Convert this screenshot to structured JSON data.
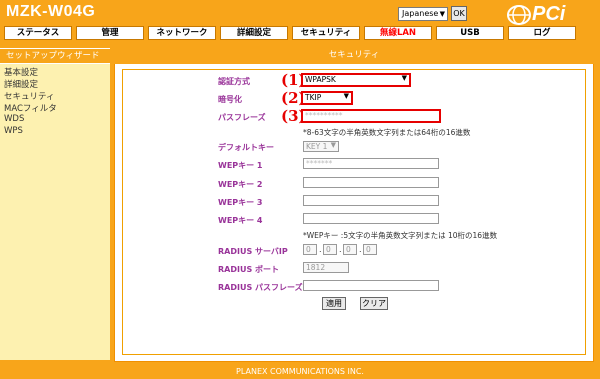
{
  "header": {
    "model": "MZK-W04G",
    "language_value": "Japanese",
    "ok_label": "OK",
    "brand_text": "PCi"
  },
  "nav": {
    "items": [
      "ステータス",
      "管理",
      "ネットワーク",
      "詳細設定",
      "セキュリティ",
      "無線LAN",
      "USB",
      "ログ"
    ],
    "active": "無線LAN"
  },
  "sidebar": {
    "header": "セットアップウィザード",
    "items": [
      "基本設定",
      "詳細設定",
      "セキュリティ",
      "MACフィルタ",
      "WDS",
      "WPS"
    ]
  },
  "main": {
    "title": "セキュリティ",
    "labels": {
      "auth": "認証方式",
      "enc": "暗号化",
      "passphrase": "パスフレーズ",
      "default_key": "デフォルトキー",
      "wep1": "WEPキー 1",
      "wep2": "WEPキー 2",
      "wep3": "WEPキー 3",
      "wep4": "WEPキー 4",
      "radius_ip": "RADIUS サーバIP",
      "radius_port": "RADIUS ポート",
      "radius_pass": "RADIUS パスフレーズ"
    },
    "values": {
      "auth": "WPAPSK",
      "enc": "TKIP",
      "passphrase": "**********",
      "default_key": "KEY 1",
      "wep1": "*******",
      "wep2": "",
      "wep3": "",
      "wep4": "",
      "ip": [
        "0",
        "0",
        "0",
        "0"
      ],
      "radius_port": "1812",
      "radius_pass": ""
    },
    "notes": {
      "passphrase": "*8-63文字の半角英数文字列または64桁の16進数",
      "wep": "*WEPキー :5文字の半角英数文字列または 10桁の16進数"
    },
    "markers": [
      "(1)",
      "(2)",
      "(3)"
    ],
    "buttons": {
      "apply": "適用",
      "clear": "クリア"
    }
  },
  "footer": {
    "text": "PLANEX COMMUNICATIONS INC."
  }
}
